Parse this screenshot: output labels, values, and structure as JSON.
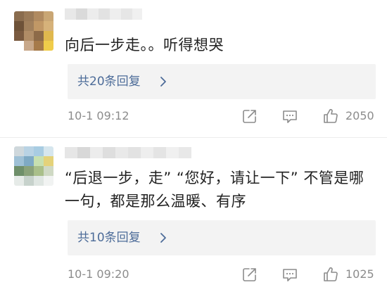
{
  "comments": [
    {
      "text": "向后一步走。。听得想哭",
      "replies_label": "共20条回复",
      "timestamp": "10-1 09:12",
      "like_count": "2050"
    },
    {
      "text": "“后退一步，走” “您好，请让一下” 不管是哪一句，都是那么温暖、有序",
      "replies_label": "共10条回复",
      "timestamp": "10-1 09:20",
      "like_count": "1025"
    }
  ],
  "icons": {
    "share": "share-icon",
    "comment": "comment-icon",
    "like": "thumbs-up-icon",
    "chevron": "chevron-right-icon"
  },
  "colors": {
    "link": "#4d6c99",
    "body_text": "#222222",
    "meta_text": "#8c8c8c",
    "reply_bg": "#f3f3f3"
  }
}
